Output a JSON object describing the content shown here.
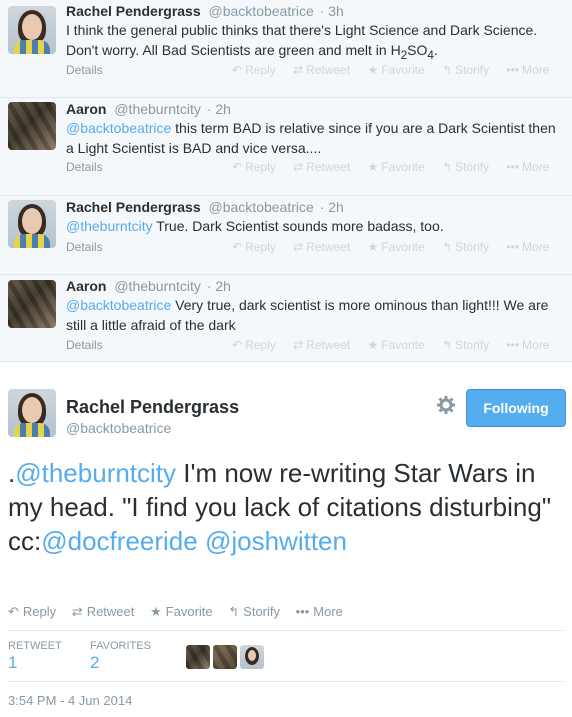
{
  "replies": [
    {
      "name": "Rachel Pendergrass",
      "handle": "@backtobeatrice",
      "time": "· 3h",
      "text_pre": "",
      "mention": "",
      "text_main": "I think the general public thinks that there's Light Science and Dark Science. Don't worry. All Bad Scientists are green and melt in H",
      "sub1": "2",
      "mid": "SO",
      "sub2": "4",
      "end": ".",
      "details": "Details"
    },
    {
      "name": "Aaron",
      "handle": "@theburntcity",
      "time": "· 2h",
      "mention": "@backtobeatrice",
      "text_main": " this term BAD is relative since if you are a Dark Scientist then a Light Scientist is BAD and vice versa....",
      "details": "Details"
    },
    {
      "name": "Rachel Pendergrass",
      "handle": "@backtobeatrice",
      "time": "· 2h",
      "mention": "@theburntcity",
      "text_main": " True. Dark Scientist sounds more badass, too.",
      "details": "Details"
    },
    {
      "name": "Aaron",
      "handle": "@theburntcity",
      "time": "· 2h",
      "mention": "@backtobeatrice",
      "text_main": " Very true, dark scientist is more ominous than light!!! We are still a little afraid of the dark",
      "details": "Details"
    }
  ],
  "actions": {
    "reply": "Reply",
    "retweet": "Retweet",
    "favorite": "Favorite",
    "storify": "Storify",
    "more": "More"
  },
  "main": {
    "name": "Rachel Pendergrass",
    "handle": "@backtobeatrice",
    "follow_label": "Following",
    "text_lead": ".",
    "mention1": "@theburntcity",
    "text_mid": " I'm now re-writing Star Wars in my head. \"I find you lack of citations disturbing\" cc:",
    "mention2": "@docfreeride",
    "space": " ",
    "mention3": "@joshwitten",
    "retweet_label": "RETWEET",
    "retweet_count": "1",
    "favorites_label": "FAVORITES",
    "favorites_count": "2",
    "timestamp": "3:54 PM - 4 Jun 2014"
  },
  "colors": {
    "link": "#55acee",
    "muted": "#8899a6",
    "thread_bg": "#f5f8fa"
  }
}
